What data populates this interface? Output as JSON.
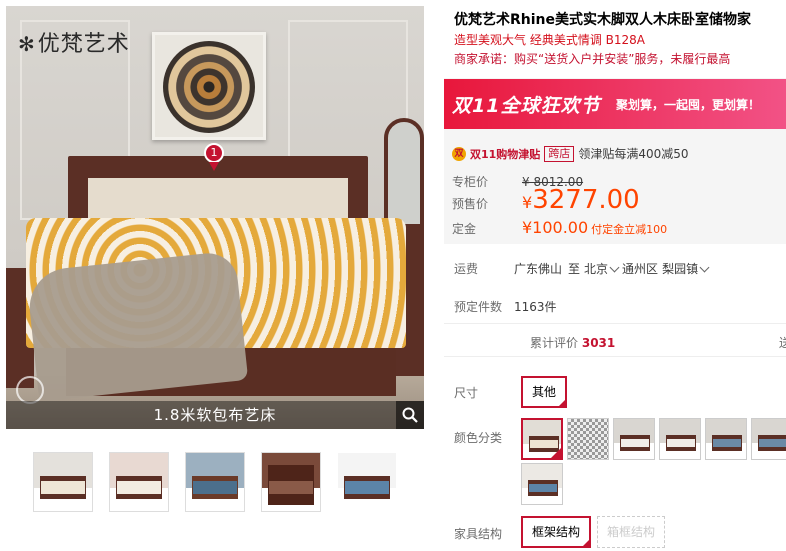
{
  "brand": {
    "logo_text": "优梵艺术"
  },
  "gallery": {
    "caption": "1.8米软包布艺床",
    "marker_number": "1",
    "thumbnails": [
      {
        "name": "thumb-1"
      },
      {
        "name": "thumb-2"
      },
      {
        "name": "thumb-3"
      },
      {
        "name": "thumb-4"
      },
      {
        "name": "thumb-5"
      }
    ]
  },
  "product": {
    "title": "优梵艺术Rhine美式实木脚双人木床卧室储物家",
    "subtitle": "造型美观大气 经典美式情调 B128A",
    "promise": "商家承诺：购买“送货入户并安装”服务，未履行最高"
  },
  "promo": {
    "banner_main": "双11全球狂欢节",
    "banner_sub": "聚划算，一起囤，更划算！",
    "coupon_icon": "双",
    "coupon_tag": "双11购物津贴",
    "coupon_tag2": "跨店",
    "coupon_text": "领津贴每满400减50"
  },
  "pricing": {
    "list_label": "专柜价",
    "list_price": "¥ 8012.00",
    "sale_label": "预售价",
    "sale_currency": "¥",
    "sale_price": "3277.00",
    "deposit_label": "定金",
    "deposit_price": "¥100.00",
    "deposit_note": "付定金立减100"
  },
  "shipping": {
    "label": "运费",
    "from": "广东佛山",
    "to_word": "至",
    "to_city": "北京",
    "to_district": "通州区",
    "to_town": "梨园镇"
  },
  "presale": {
    "label": "预定件数",
    "count": "1163件"
  },
  "stats": {
    "review_label": "累计评价",
    "review_count": "3031",
    "next": "送"
  },
  "options": {
    "size_label": "尺寸",
    "size_value": "其他",
    "color_label": "颜色分类",
    "structure_label": "家具结构",
    "structure_options": [
      "框架结构",
      "箱框结构"
    ]
  },
  "colors": {
    "accent": "#c41230",
    "price": "#ff4400",
    "banner_start": "#e8173b",
    "banner_end": "#f25286"
  }
}
